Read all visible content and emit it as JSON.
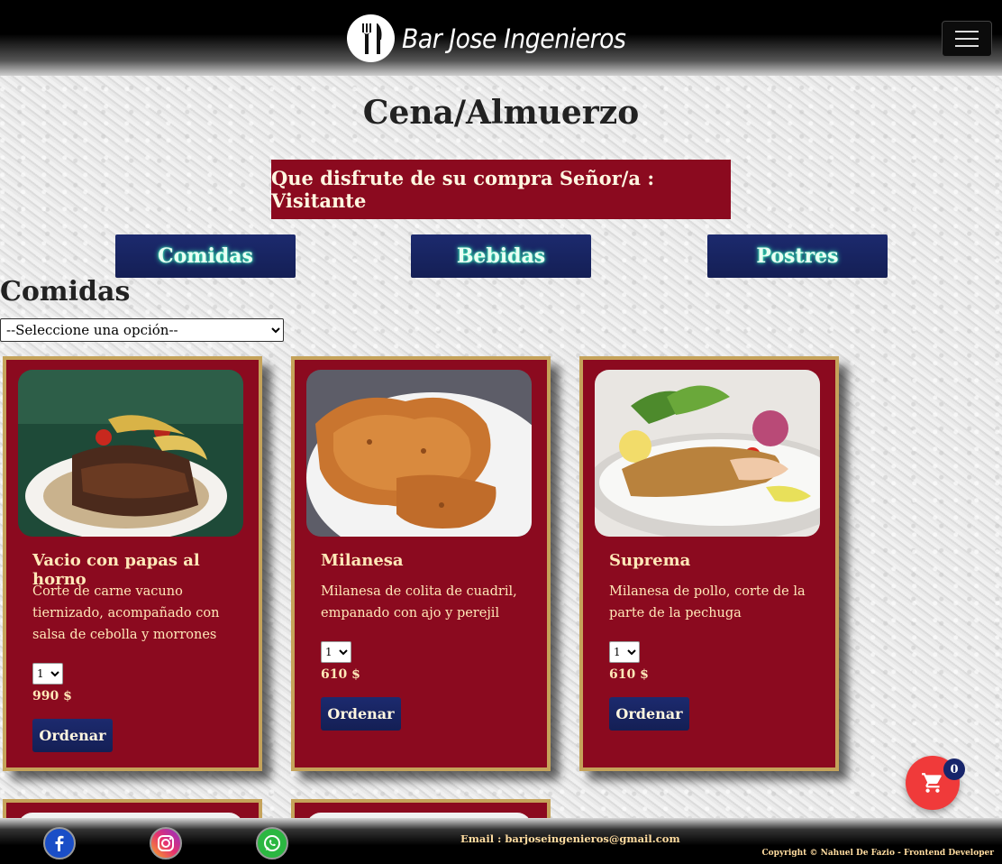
{
  "navbar": {
    "brand_name": "Bar Jose Ingenieros",
    "logo_icon": "fork-knife-icon",
    "menu_icon": "hamburger-menu-icon"
  },
  "page": {
    "title": "Cena/Almuerzo",
    "welcome": "Que disfrute de su compra Señor/a : Visitante"
  },
  "categories": [
    "Comidas",
    "Bebidas",
    "Postres"
  ],
  "section": {
    "title": "Comidas",
    "filter_selected": "--Seleccione una opción--"
  },
  "products": [
    {
      "name": "Vacio con papas al horno",
      "description": "Corte de carne vacuno tiernizado, acompañado con salsa de cebolla y morrones",
      "qty": "1",
      "price": "990 $",
      "order_label": "Ordenar"
    },
    {
      "name": "Milanesa",
      "description": "Milanesa de colita de cuadril, empanado con ajo y perejil",
      "qty": "1",
      "price": "610 $",
      "order_label": "Ordenar"
    },
    {
      "name": "Suprema",
      "description": "Milanesa de pollo, corte de la parte de la pechuga",
      "qty": "1",
      "price": "610 $",
      "order_label": "Ordenar"
    }
  ],
  "cart": {
    "icon": "shopping-cart-icon",
    "count": "0"
  },
  "footer": {
    "social_icons": [
      "facebook-icon",
      "instagram-icon",
      "whatsapp-icon"
    ],
    "email": "Email : barjoseingenieros@gmail.com",
    "copyright": "Copyright © Nahuel De Fazio - Frontend Developer"
  },
  "colors": {
    "card_background": "#8b0a1f",
    "card_border": "#c5a35a",
    "button_navy": "#1c2a6e",
    "cart_red": "#f03a3a"
  }
}
